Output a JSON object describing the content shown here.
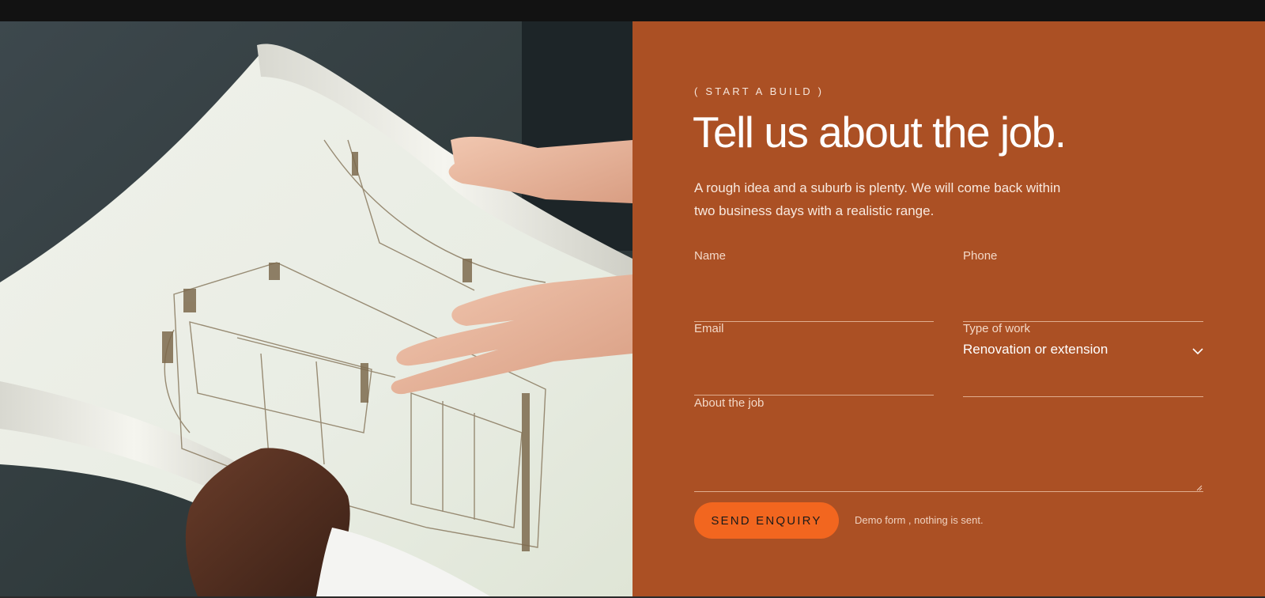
{
  "photo": {
    "alt_icon": "blueprint-photo"
  },
  "form_section": {
    "eyebrow": "( START A BUILD )",
    "headline": "Tell us about the job.",
    "lede": "A rough idea and a suburb is plenty. We will come back within two business days with a realistic range.",
    "fields": {
      "name": {
        "label": "Name",
        "value": ""
      },
      "phone": {
        "label": "Phone",
        "value": ""
      },
      "email": {
        "label": "Email",
        "value": ""
      },
      "type_of_work": {
        "label": "Type of work",
        "selected": "Renovation or extension"
      },
      "about": {
        "label": "About the job",
        "value": ""
      }
    },
    "submit_label": "SEND ENQUIRY",
    "note": "Demo form , nothing is sent."
  },
  "colors": {
    "panel_background": "#ab5024",
    "button_background": "#f2661f",
    "page_background": "#121212"
  }
}
